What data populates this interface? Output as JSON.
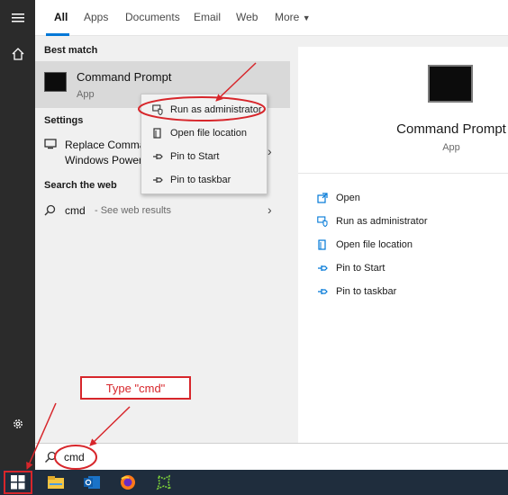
{
  "tabs": [
    {
      "label": "All"
    },
    {
      "label": "Apps"
    },
    {
      "label": "Documents"
    },
    {
      "label": "Email"
    },
    {
      "label": "Web"
    },
    {
      "label": "More"
    }
  ],
  "results": {
    "best_match_header": "Best match",
    "best_match": {
      "title": "Command Prompt",
      "subtitle": "App"
    },
    "settings_header": "Settings",
    "settings_item": {
      "line1": "Replace Comma",
      "line2": "Windows Power"
    },
    "web_header": "Search the web",
    "web_item": {
      "query": "cmd",
      "hint": "- See web results"
    }
  },
  "context_menu": {
    "items": [
      {
        "label": "Run as administrator",
        "icon": "shield-icon"
      },
      {
        "label": "Open file location",
        "icon": "folder-icon"
      },
      {
        "label": "Pin to Start",
        "icon": "pin-icon"
      },
      {
        "label": "Pin to taskbar",
        "icon": "pin-icon"
      }
    ]
  },
  "detail": {
    "title": "Command Prompt",
    "subtitle": "App",
    "actions": [
      {
        "label": "Open",
        "icon": "open-icon"
      },
      {
        "label": "Run as administrator",
        "icon": "shield-icon"
      },
      {
        "label": "Open file location",
        "icon": "file-icon"
      },
      {
        "label": "Pin to Start",
        "icon": "pin-icon"
      },
      {
        "label": "Pin to taskbar",
        "icon": "pin-icon"
      }
    ]
  },
  "search": {
    "value": "cmd"
  },
  "annotation": {
    "callout": "Type \"cmd\""
  },
  "colors": {
    "accent": "#0078d7",
    "annotation_red": "#d7262b",
    "taskbar": "#1f2d3d"
  },
  "taskbar": {
    "apps": [
      {
        "icon": "windows-start-icon"
      },
      {
        "icon": "file-explorer-icon"
      },
      {
        "icon": "outlook-icon"
      },
      {
        "icon": "firefox-icon"
      },
      {
        "icon": "green-app-icon"
      }
    ]
  }
}
